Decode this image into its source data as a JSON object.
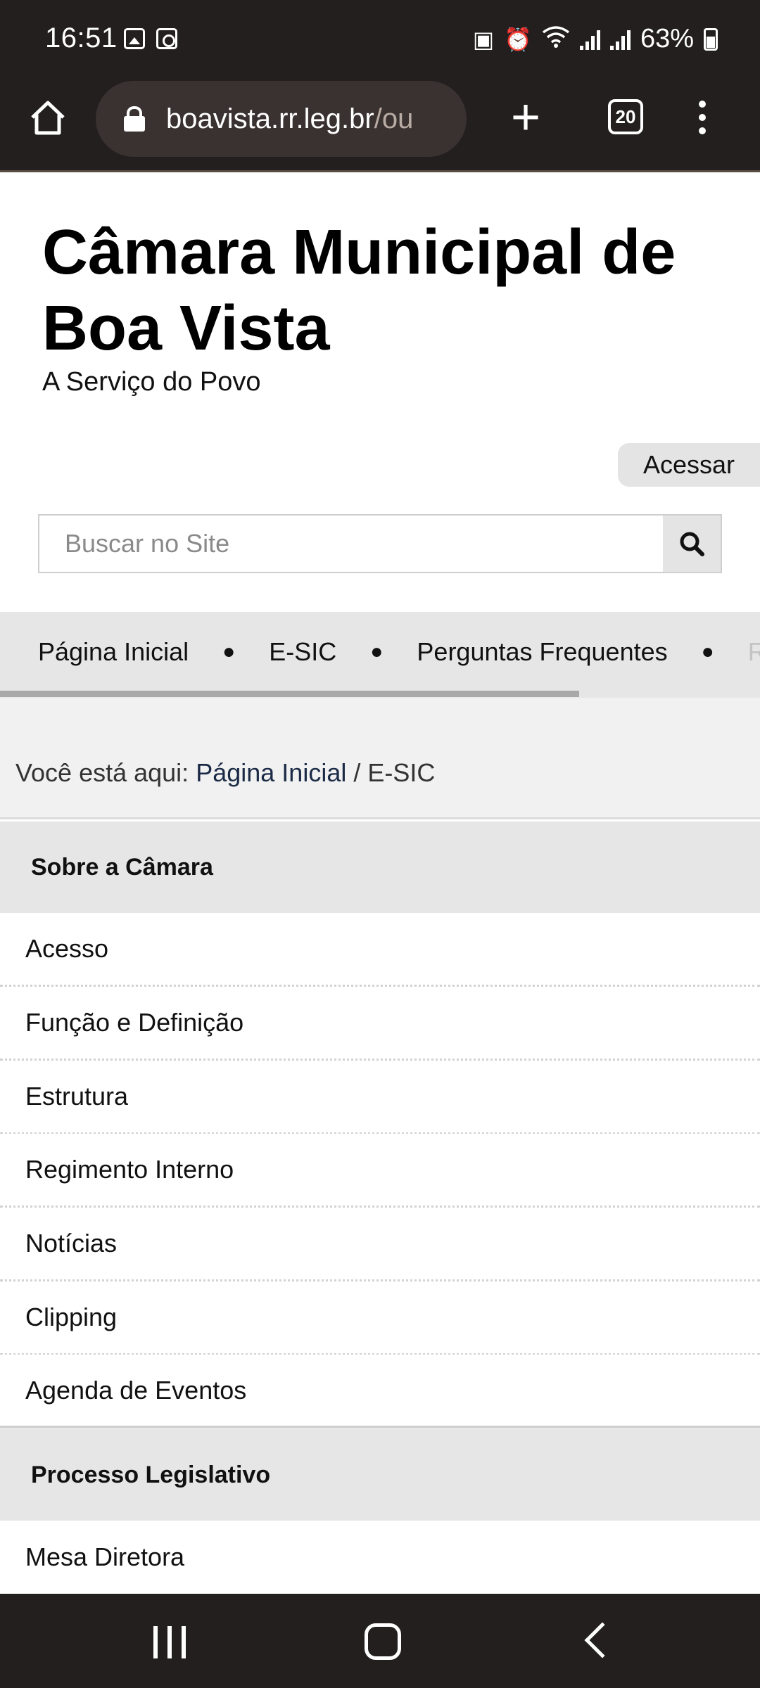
{
  "status_bar": {
    "time": "16:51",
    "battery": "63%",
    "icons": [
      "gallery-icon",
      "clock-app-icon",
      "battery-saver-icon",
      "alarm-icon",
      "wifi-icon",
      "signal-icon",
      "signal-icon",
      "battery-icon"
    ]
  },
  "browser": {
    "url_main": "boavista.rr.leg.br",
    "url_rest": "/ou",
    "tab_count": "20"
  },
  "header": {
    "title": "Câmara Municipal de Boa Vista",
    "subtitle": "A Serviço do Povo",
    "login_label": "Acessar"
  },
  "search": {
    "placeholder": "Buscar no Site"
  },
  "nav": {
    "items": [
      "Página Inicial",
      "E-SIC",
      "Perguntas Frequentes",
      "RSS"
    ]
  },
  "breadcrumb": {
    "prefix": "Você está aqui:",
    "home": "Página Inicial",
    "separator": "/",
    "current": "E-SIC"
  },
  "menu": {
    "section1": {
      "title": "Sobre a Câmara",
      "items": [
        "Acesso",
        "Função e Definição",
        "Estrutura",
        "Regimento Interno",
        "Notícias",
        "Clipping",
        "Agenda de Eventos"
      ]
    },
    "section2": {
      "title": "Processo Legislativo",
      "items": [
        "Mesa Diretora"
      ]
    }
  },
  "colors": {
    "chrome_bg": "#231f1f",
    "url_bar_bg": "#3a3230",
    "section_bg": "#e6e6e6",
    "breadcrumb_link": "#1b2b46"
  }
}
